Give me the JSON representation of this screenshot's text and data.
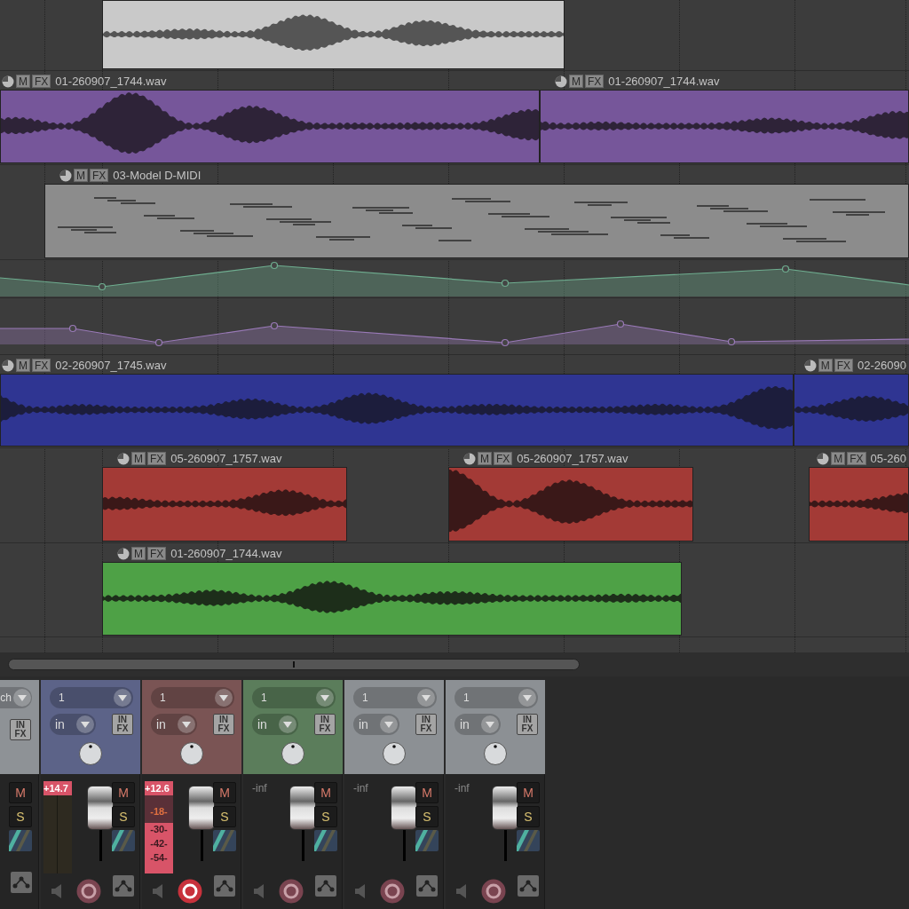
{
  "arrange": {
    "lanes": [
      {
        "kind": "track",
        "color": "#c9c9c9",
        "items": [
          {
            "kind": "audio"
          }
        ]
      },
      {
        "kind": "track",
        "color": "#76569a",
        "items": [
          {
            "kind": "audio",
            "label": "01-260907_1744.wav",
            "buttons": [
              "M",
              "FX"
            ]
          },
          {
            "kind": "audio",
            "label": "01-260907_1744.wav",
            "buttons": [
              "M",
              "FX"
            ]
          }
        ]
      },
      {
        "kind": "track",
        "color": "#8c8c8c",
        "items": [
          {
            "kind": "midi",
            "label": "03-Model D-MIDI",
            "buttons": [
              "M",
              "FX"
            ]
          }
        ]
      },
      {
        "kind": "envelope",
        "color": "#6fae90"
      },
      {
        "kind": "envelope",
        "color": "#9a7ab8"
      },
      {
        "kind": "track",
        "color": "#2f3592",
        "items": [
          {
            "kind": "audio",
            "label": "02-260907_1745.wav",
            "buttons": [
              "M",
              "FX"
            ]
          },
          {
            "kind": "audio",
            "label": "02-26090",
            "buttons": [
              "M",
              "FX"
            ]
          }
        ]
      },
      {
        "kind": "track",
        "color": "#a33a36",
        "items": [
          {
            "kind": "audio",
            "label": "05-260907_1757.wav",
            "buttons": [
              "M",
              "FX"
            ]
          },
          {
            "kind": "audio",
            "label": "05-260907_1757.wav",
            "buttons": [
              "M",
              "FX"
            ]
          },
          {
            "kind": "audio",
            "label": "05-260",
            "buttons": [
              "M",
              "FX"
            ]
          }
        ]
      },
      {
        "kind": "track",
        "color": "#4ea146",
        "items": [
          {
            "kind": "audio",
            "label": "01-260907_1744.wav",
            "buttons": [
              "M",
              "FX"
            ]
          }
        ]
      }
    ]
  },
  "mixer": {
    "strips": [
      {
        "kind": "partial",
        "color": "#8e9296",
        "input": "ch",
        "fx_button": "IN FX",
        "mute": "M",
        "solo": "S"
      },
      {
        "kind": "full",
        "color": "#5c6388",
        "channel": "1",
        "input": "in",
        "fx_button": "IN FX",
        "meter": {
          "peak": "+14.7",
          "level": 0
        },
        "fader": {
          "level": 0.85
        },
        "mute": "M",
        "solo": "S",
        "armed": false
      },
      {
        "kind": "full",
        "color": "#7a5454",
        "channel": "1",
        "input": "in",
        "fx_button": "IN FX",
        "meter": {
          "peak": "+12.6",
          "level": 0.55,
          "scale": [
            "-18-",
            "-30-",
            "-42-",
            "-54-"
          ]
        },
        "fader": {
          "level": 0.85
        },
        "mute": "M",
        "solo": "S",
        "armed": true
      },
      {
        "kind": "full",
        "color": "#5b7d5b",
        "channel": "1",
        "input": "in",
        "fx_button": "IN FX",
        "reading": "-inf",
        "fader": {
          "level": 0.85
        },
        "mute": "M",
        "solo": "S",
        "armed": false
      },
      {
        "kind": "full",
        "color": "#8c9094",
        "channel": "1",
        "input": "in",
        "fx_button": "IN FX",
        "reading": "-inf",
        "fader": {
          "level": 0.85
        },
        "mute": "M",
        "solo": "S",
        "armed": false
      },
      {
        "kind": "full",
        "color": "#8c9094",
        "channel": "1",
        "input": "in",
        "fx_button": "IN FX",
        "reading": "-inf",
        "fader": {
          "level": 0.85
        },
        "mute": "M",
        "solo": "S",
        "armed": false
      }
    ]
  }
}
